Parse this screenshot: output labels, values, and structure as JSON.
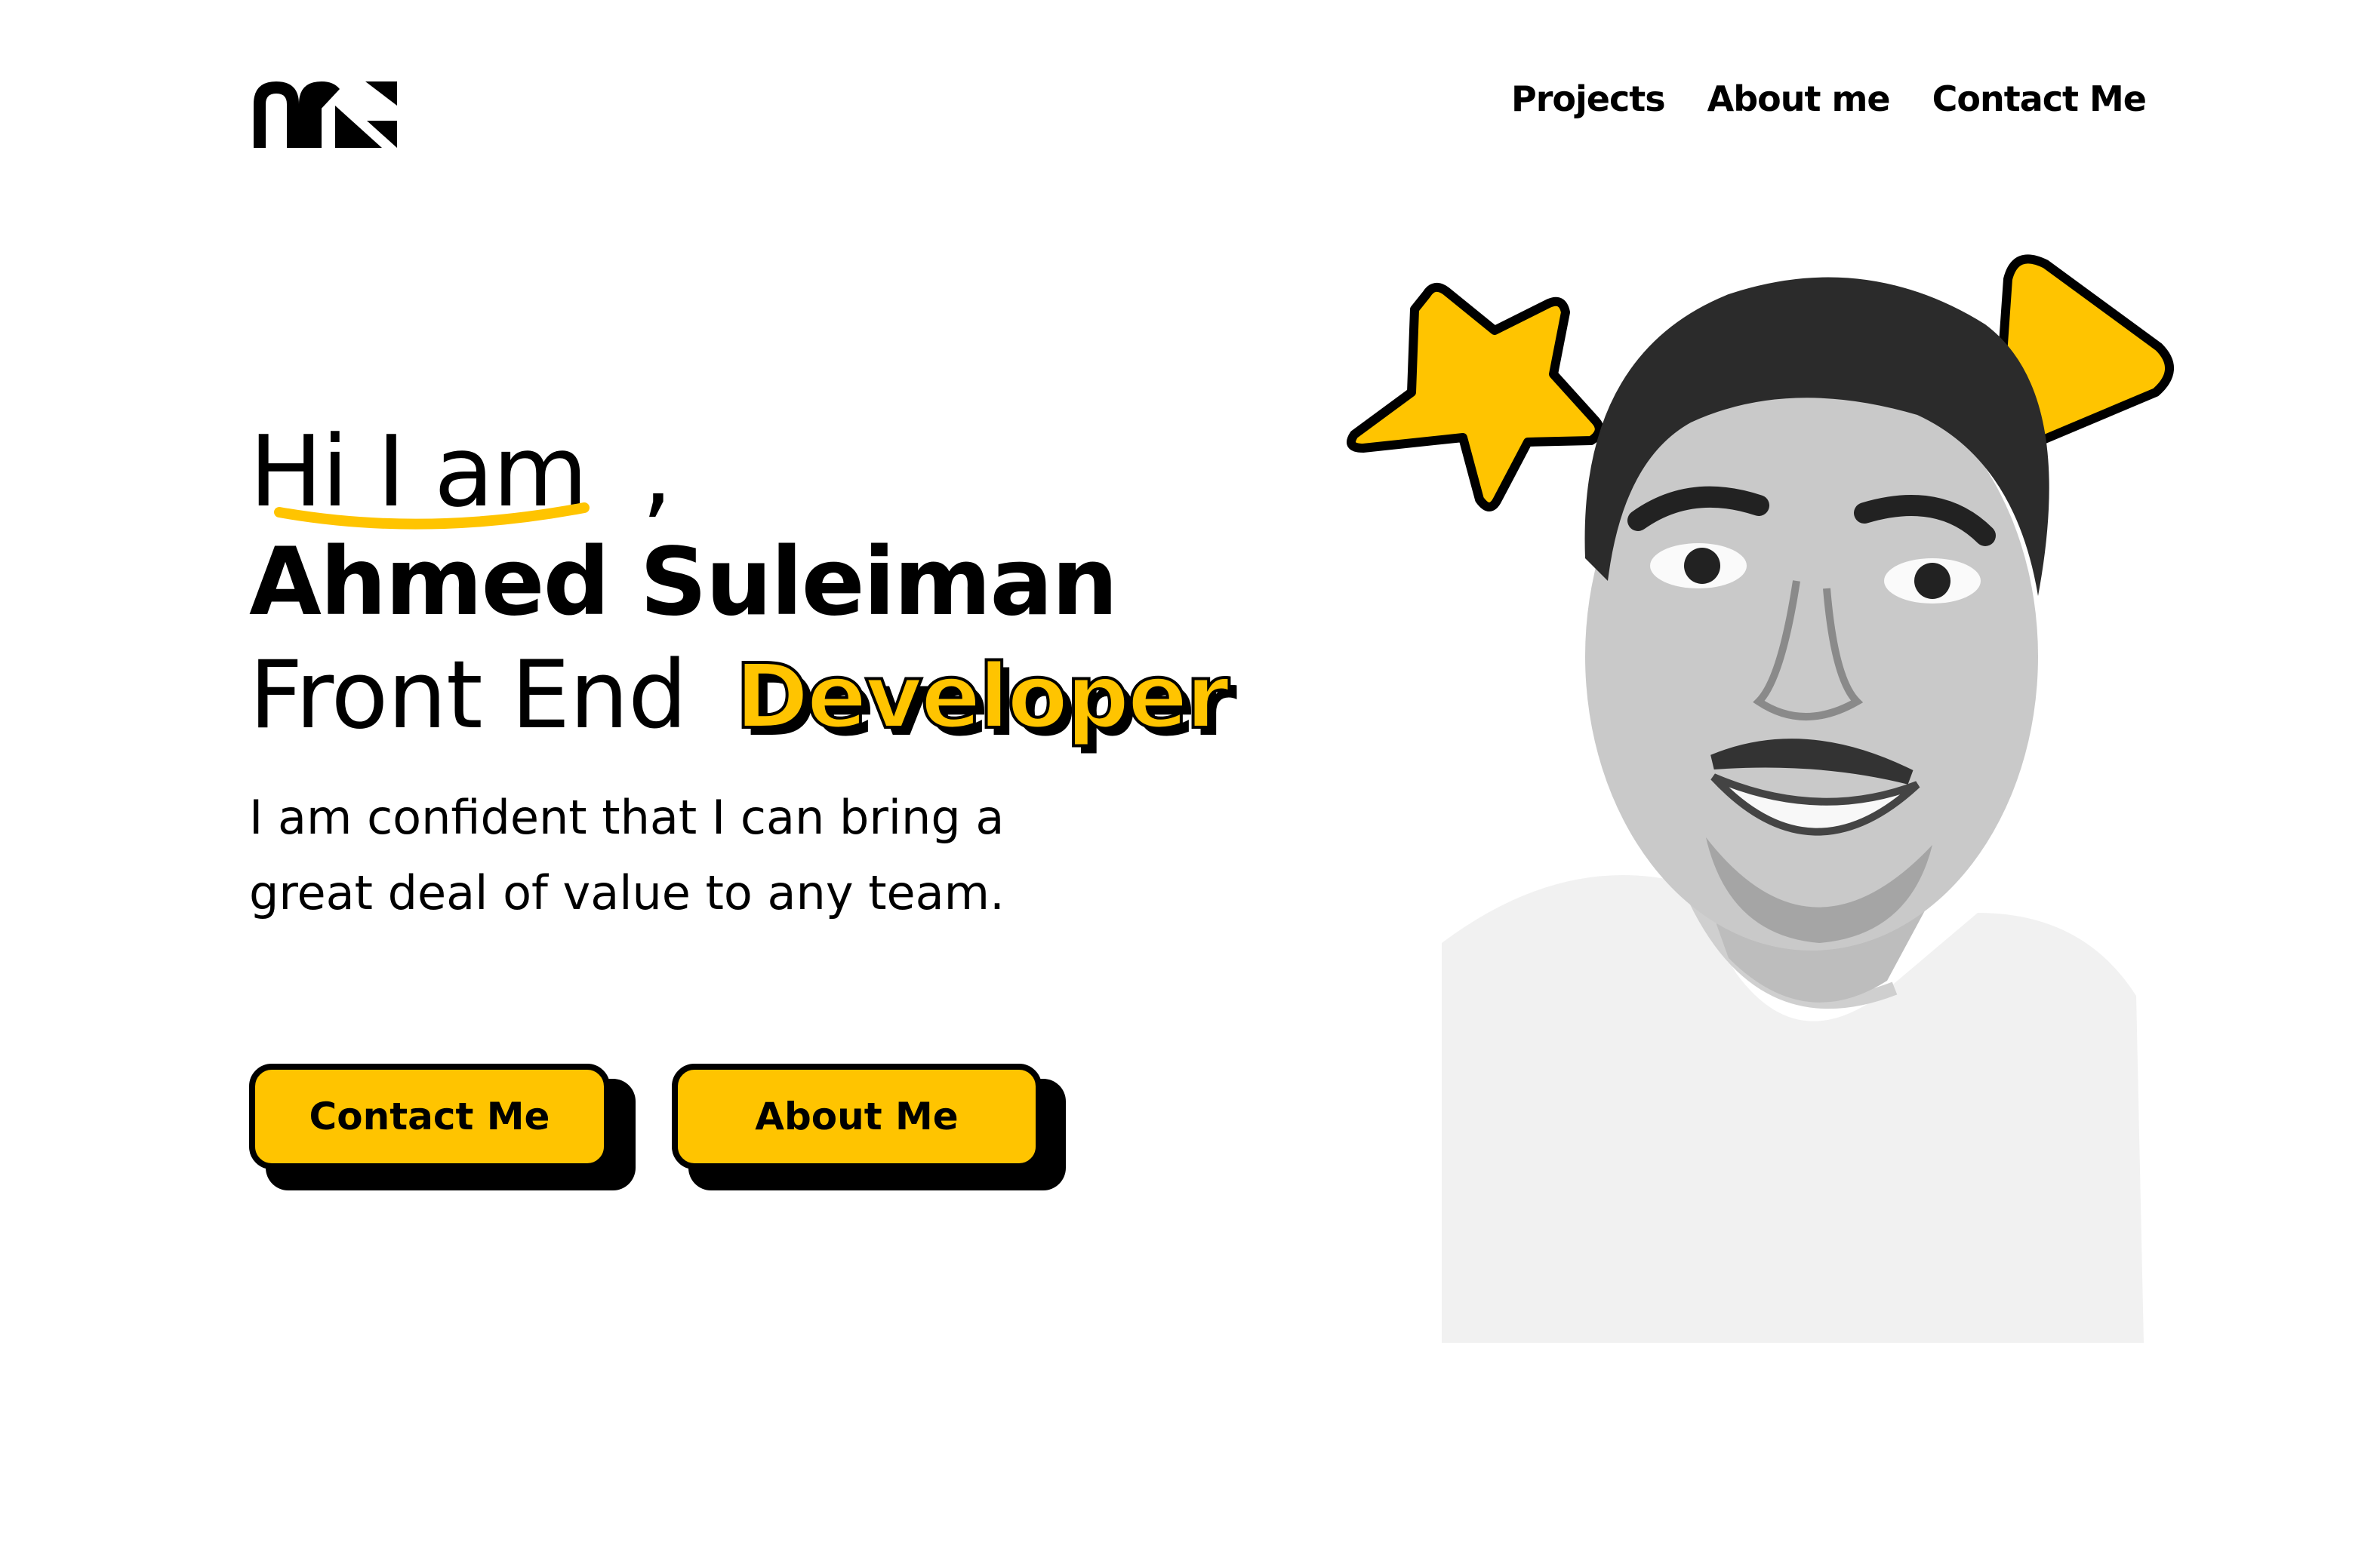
{
  "logo": {
    "text": "ns",
    "icon": "ns-monogram-logo"
  },
  "nav": {
    "items": [
      {
        "label": "Projects"
      },
      {
        "label": "About me"
      },
      {
        "label": "Contact Me"
      }
    ]
  },
  "hero": {
    "greeting": "Hi I am",
    "comma": ",",
    "name": "Ahmed Suleiman",
    "role_prefix": "Front End",
    "role_accent": "Developer",
    "tagline_line1": "I am confident that I can bring a",
    "tagline_line2": "great deal of value to any team."
  },
  "buttons": {
    "contact_label": "Contact Me",
    "about_label": "About Me"
  },
  "colors": {
    "accent": "#FFC400",
    "text": "#000000",
    "background": "#FFFFFF"
  },
  "decorations": {
    "star_icon": "star-icon",
    "triangle_icon": "rounded-triangle-icon",
    "portrait": "black-and-white portrait photo"
  }
}
